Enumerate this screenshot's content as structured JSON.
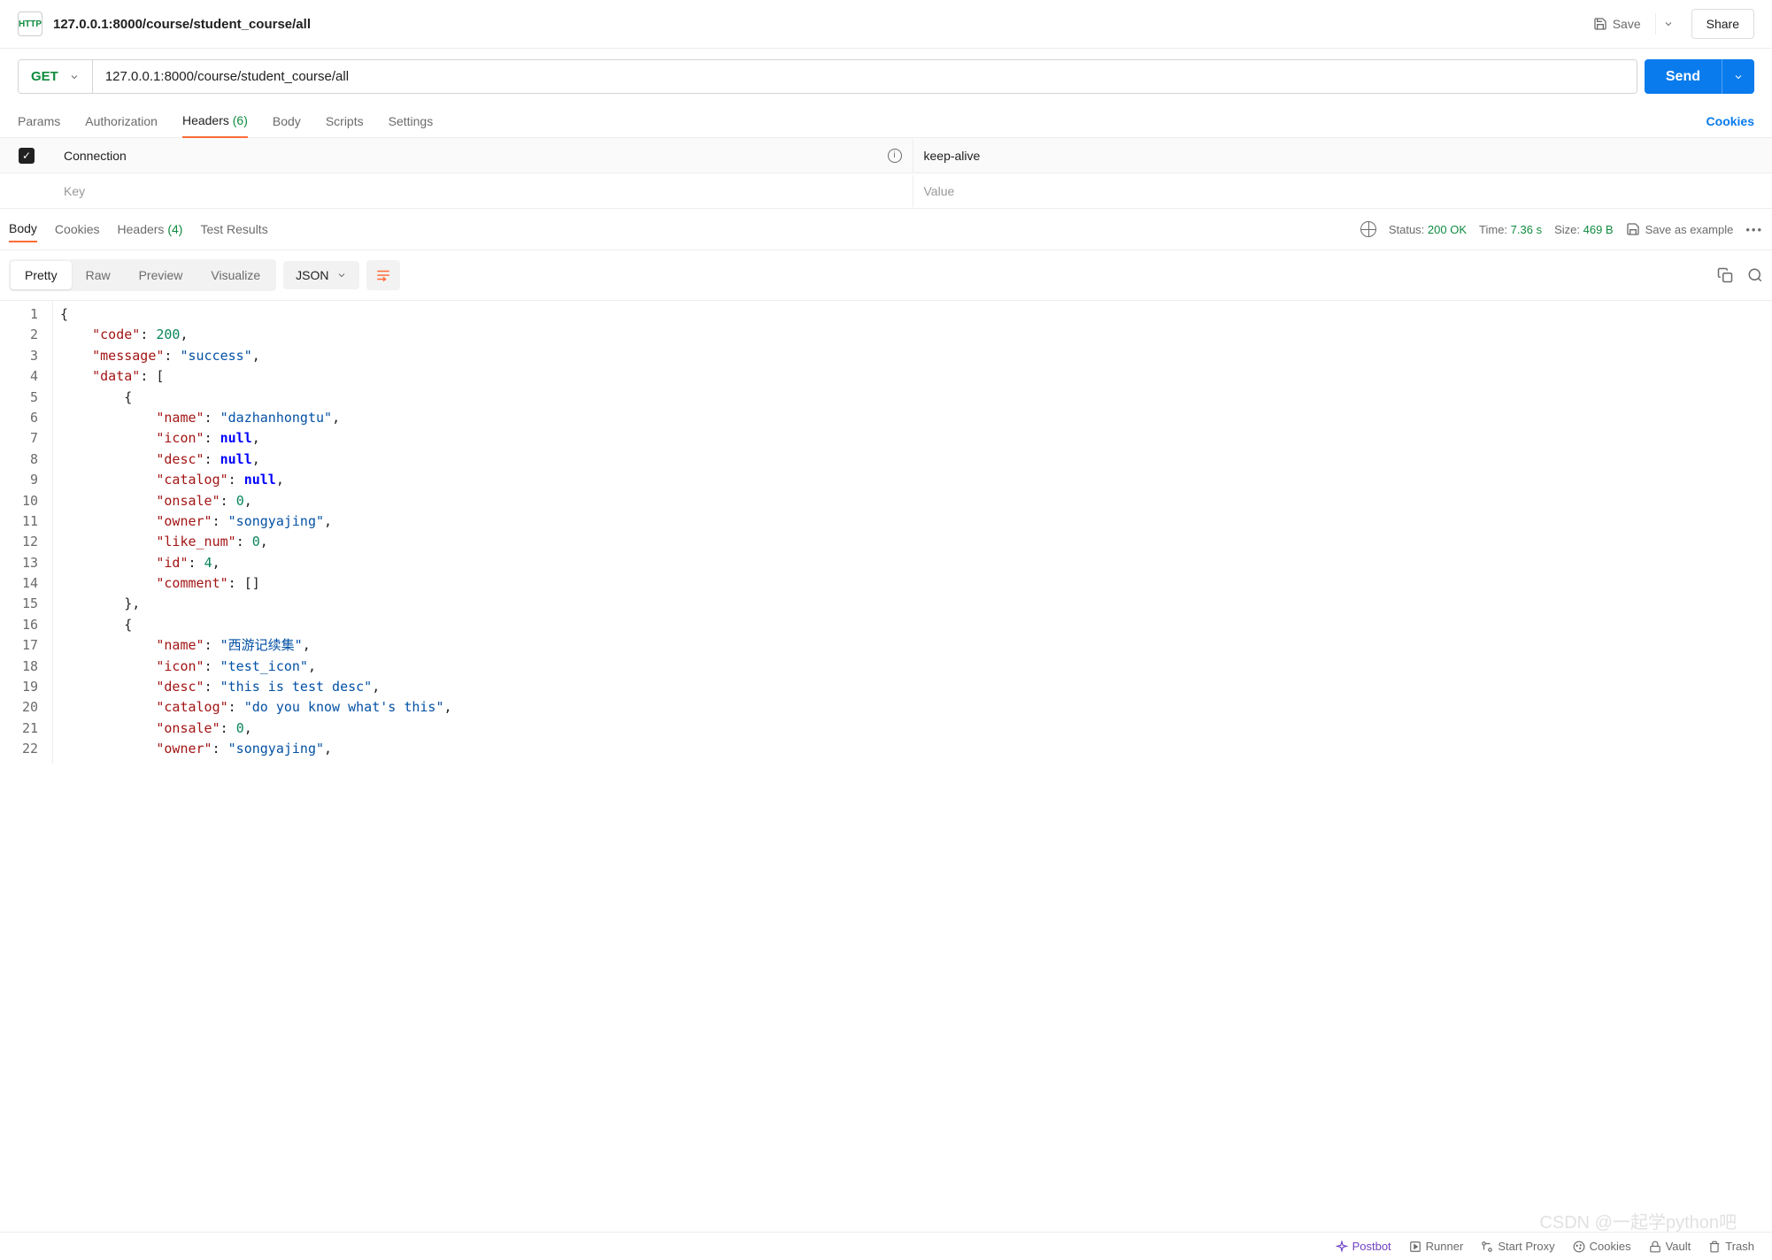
{
  "topbar": {
    "httpLabel": "HTTP",
    "tabTitle": "127.0.0.1:8000/course/student_course/all",
    "saveLabel": "Save",
    "shareLabel": "Share"
  },
  "request": {
    "method": "GET",
    "url": "127.0.0.1:8000/course/student_course/all",
    "sendLabel": "Send"
  },
  "reqTabs": {
    "params": "Params",
    "authorization": "Authorization",
    "headers": "Headers",
    "headersCount": "(6)",
    "body": "Body",
    "scripts": "Scripts",
    "settings": "Settings",
    "cookiesLink": "Cookies"
  },
  "headerRow": {
    "key": "Connection",
    "value": "keep-alive",
    "keyPlaceholder": "Key",
    "valuePlaceholder": "Value"
  },
  "respTabs": {
    "body": "Body",
    "cookies": "Cookies",
    "headers": "Headers",
    "headersCount": "(4)",
    "testResults": "Test Results"
  },
  "respStatus": {
    "statusLabel": "Status:",
    "statusValue": "200 OK",
    "timeLabel": "Time:",
    "timeValue": "7.36 s",
    "sizeLabel": "Size:",
    "sizeValue": "469 B",
    "saveExample": "Save as example"
  },
  "viewTabs": {
    "pretty": "Pretty",
    "raw": "Raw",
    "preview": "Preview",
    "visualize": "Visualize",
    "format": "JSON"
  },
  "responseBody": {
    "code": 200,
    "message": "success",
    "data": [
      {
        "name": "dazhanhongtu",
        "icon": null,
        "desc": null,
        "catalog": null,
        "onsale": 0,
        "owner": "songyajing",
        "like_num": 0,
        "id": 4,
        "comment": []
      },
      {
        "name": "西游记续集",
        "icon": "test_icon",
        "desc": "this is test desc",
        "catalog": "do you know what's this",
        "onsale": 0,
        "owner": "songyajing"
      }
    ]
  },
  "bottomBar": {
    "postbot": "Postbot",
    "runner": "Runner",
    "startProxy": "Start Proxy",
    "cookies": "Cookies",
    "vault": "Vault",
    "trash": "Trash"
  },
  "watermark": "CSDN @一起学python吧"
}
